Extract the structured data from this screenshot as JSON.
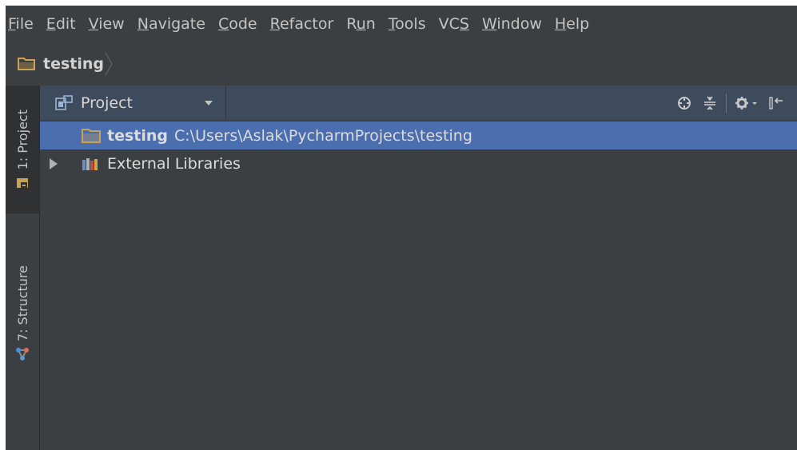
{
  "menu": [
    {
      "label": "File",
      "mnemonic": "F",
      "rest": "ile"
    },
    {
      "label": "Edit",
      "mnemonic": "E",
      "rest": "dit"
    },
    {
      "label": "View",
      "mnemonic": "V",
      "rest": "iew"
    },
    {
      "label": "Navigate",
      "mnemonic": "N",
      "rest": "avigate"
    },
    {
      "label": "Code",
      "mnemonic": "C",
      "rest": "ode"
    },
    {
      "label": "Refactor",
      "mnemonic": "R",
      "rest": "efactor"
    },
    {
      "label": "Run",
      "pre": "R",
      "mnemonic": "u",
      "rest": "n"
    },
    {
      "label": "Tools",
      "mnemonic": "T",
      "rest": "ools"
    },
    {
      "label": "VCS",
      "pre": "VC",
      "mnemonic": "S",
      "rest": ""
    },
    {
      "label": "Window",
      "mnemonic": "W",
      "rest": "indow"
    },
    {
      "label": "Help",
      "mnemonic": "H",
      "rest": "elp"
    }
  ],
  "breadcrumb": {
    "label": "testing"
  },
  "toolwindows": {
    "project": {
      "label": "1: Project"
    },
    "structure": {
      "label": "7: Structure"
    }
  },
  "panel": {
    "view_label": "Project",
    "tree": [
      {
        "name": "testing",
        "path": "C:\\Users\\Aslak\\PycharmProjects\\testing",
        "selected": true
      },
      {
        "name": "External Libraries",
        "selected": false
      }
    ]
  },
  "colors": {
    "background": "#3c3f41",
    "header": "#3e4b5c",
    "selection": "#4b6eaf",
    "folder": "#c9a256",
    "text": "#c4c4c4"
  },
  "icons": [
    "folder-icon",
    "project-view-icon",
    "dropdown-arrow-icon",
    "locate-icon",
    "collapse-all-icon",
    "gear-icon",
    "hide-panel-icon",
    "expand-arrow-icon",
    "libraries-icon",
    "structure-icon"
  ]
}
